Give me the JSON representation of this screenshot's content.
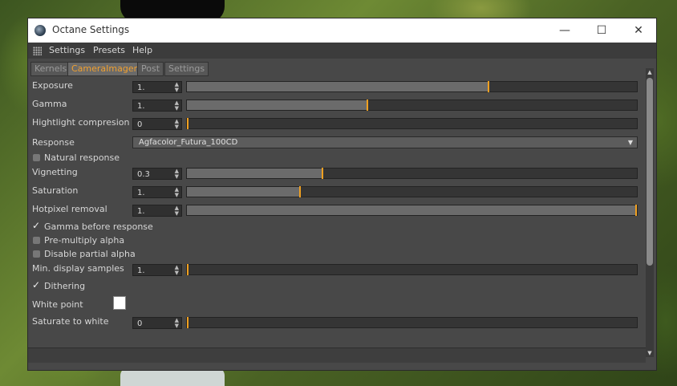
{
  "window": {
    "title": "Octane Settings",
    "minimize_glyph": "—",
    "maximize_glyph": "☐",
    "close_glyph": "✕"
  },
  "menu": [
    "Settings",
    "Presets",
    "Help"
  ],
  "tabs": [
    {
      "label": "Kernels",
      "active": false
    },
    {
      "label": "CameraImager",
      "active": true
    },
    {
      "label": "Post",
      "active": false
    },
    {
      "label": "Settings",
      "active": false
    }
  ],
  "params": {
    "exposure": {
      "label": "Exposure",
      "value": "1.",
      "slider_fraction": 0.67
    },
    "gamma": {
      "label": "Gamma",
      "value": "1.",
      "slider_fraction": 0.4
    },
    "highlight": {
      "label": "Hightlight compresion",
      "value": "0",
      "slider_fraction": 0.0
    },
    "response": {
      "label": "Response",
      "value": "Agfacolor_Futura_100CD"
    },
    "natural_response": {
      "label": "Natural response",
      "checked": false
    },
    "vignetting": {
      "label": "Vignetting",
      "value": "0.3",
      "slider_fraction": 0.3
    },
    "saturation": {
      "label": "Saturation",
      "value": "1.",
      "slider_fraction": 0.25
    },
    "hotpixel": {
      "label": "Hotpixel removal",
      "value": "1.",
      "slider_fraction": 1.0
    },
    "gamma_before_response": {
      "label": "Gamma before response",
      "checked": true
    },
    "premultiply_alpha": {
      "label": "Pre-multiply alpha",
      "checked": false
    },
    "disable_partial_alpha": {
      "label": "Disable partial alpha",
      "checked": false
    },
    "min_display_samples": {
      "label": "Min. display samples",
      "value": "1.",
      "slider_fraction": 0.0
    },
    "dithering": {
      "label": "Dithering",
      "checked": true
    },
    "white_point": {
      "label": "White point",
      "color": "#ffffff"
    },
    "saturate_to_white": {
      "label": "Saturate to white",
      "value": "0",
      "slider_fraction": 0.0
    }
  },
  "colors": {
    "accent": "#f0a020",
    "panel": "#484848"
  }
}
